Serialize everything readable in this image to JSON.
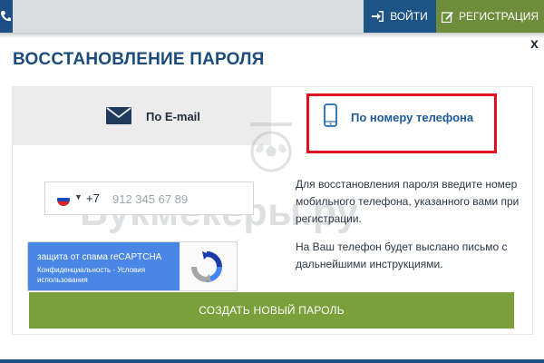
{
  "header": {
    "login_label": "ВОЙТИ",
    "register_label": "РЕГИСТРАЦИЯ"
  },
  "modal": {
    "close_label": "x",
    "title": "ВОССТАНОВЛЕНИЕ ПАРОЛЯ",
    "tabs": [
      {
        "label": "По E-mail",
        "icon": "envelope-icon",
        "active": false
      },
      {
        "label": "По номеру телефона",
        "icon": "smartphone-icon",
        "active": true
      }
    ],
    "phone": {
      "country_code": "+7",
      "placeholder": "912 345 67 89",
      "flag": "russia-flag-icon"
    },
    "info": [
      "Для восстановления пароля введите номер мобильного телефона, указанного вами при регистрации.",
      "На Ваш телефон будет выслано письмо с дальнейшими инструкциями."
    ],
    "recaptcha": {
      "title": "защита от спама reCAPTCHA",
      "links": "Конфиденциальность - Условия использования"
    },
    "submit_label": "СОЗДАТЬ НОВЫЙ ПАРОЛЬ"
  },
  "watermark": "Букмекеры.ру",
  "colors": {
    "primary": "#1e5386",
    "green": "#79a03a",
    "highlight": "#e0121d"
  }
}
